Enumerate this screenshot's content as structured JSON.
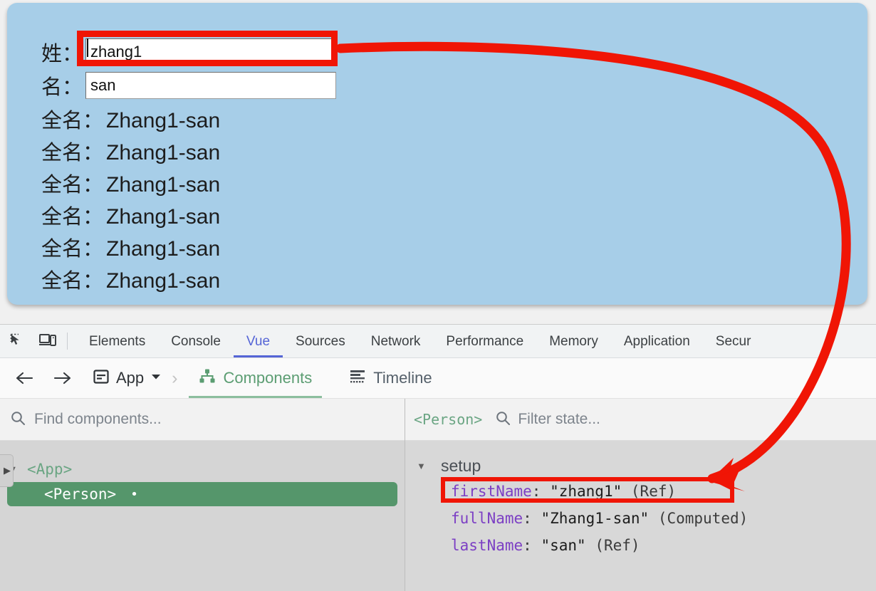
{
  "app": {
    "fields": [
      {
        "label": "姓：",
        "value": "zhang1",
        "name": "first-name"
      },
      {
        "label": "名：",
        "value": "san",
        "name": "last-name"
      }
    ],
    "fullname_label": "全名：",
    "fullname_value": "Zhang1-san",
    "fullname_count": 6,
    "panel_color": "#a7cee8"
  },
  "devtools": {
    "icons": {
      "inspect": "inspect-element-icon",
      "device": "device-toolbar-icon"
    },
    "tabs": [
      {
        "label": "Elements",
        "active": false
      },
      {
        "label": "Console",
        "active": false
      },
      {
        "label": "Vue",
        "active": true
      },
      {
        "label": "Sources",
        "active": false
      },
      {
        "label": "Network",
        "active": false
      },
      {
        "label": "Performance",
        "active": false
      },
      {
        "label": "Memory",
        "active": false
      },
      {
        "label": "Application",
        "active": false
      },
      {
        "label": "Secur",
        "active": false
      }
    ],
    "active_tab_color": "#5565d6"
  },
  "vue_toolbar": {
    "back_icon": "arrow-left-icon",
    "forward_icon": "arrow-right-icon",
    "app_icon": "app-document-icon",
    "app_name": "App",
    "dropdown_icon": "chevron-down-icon",
    "breadcrumb_separator": "›",
    "tabs": [
      {
        "label": "Components",
        "icon": "component-tree-icon",
        "active": true
      },
      {
        "label": "Timeline",
        "icon": "timeline-icon",
        "active": false
      }
    ],
    "active_color": "#5b9d72"
  },
  "tree_pane": {
    "search_icon": "search-icon",
    "search_placeholder": "Find components...",
    "nodes": [
      {
        "label": "<App>",
        "triangle": "▼",
        "selected": false,
        "dot": ""
      },
      {
        "label": "<Person>",
        "triangle": "",
        "selected": true,
        "dot": "•"
      }
    ],
    "handle_icon": "collapse-handle-icon",
    "selected_color": "#55966b"
  },
  "state_pane": {
    "component_chip": "<Person>",
    "search_icon": "search-icon",
    "search_placeholder": "Filter state...",
    "group": {
      "label": "setup",
      "triangle": "▼"
    },
    "rows": [
      {
        "key": "firstName",
        "sep": ": ",
        "value": "\"zhang1\"",
        "type": "(Ref)",
        "highlighted": true
      },
      {
        "key": "fullName",
        "sep": ": ",
        "value": "\"Zhang1-san\"",
        "type": "(Computed)",
        "highlighted": false
      },
      {
        "key": "lastName",
        "sep": ": ",
        "value": "\"san\"",
        "type": "(Ref)",
        "highlighted": false
      }
    ]
  },
  "annotations": {
    "highlight_color": "#f01505",
    "arrow_name": "red-annotation-arrow",
    "input_box_name": "first-name-input-highlight",
    "state_box_name": "firstname-state-highlight"
  }
}
